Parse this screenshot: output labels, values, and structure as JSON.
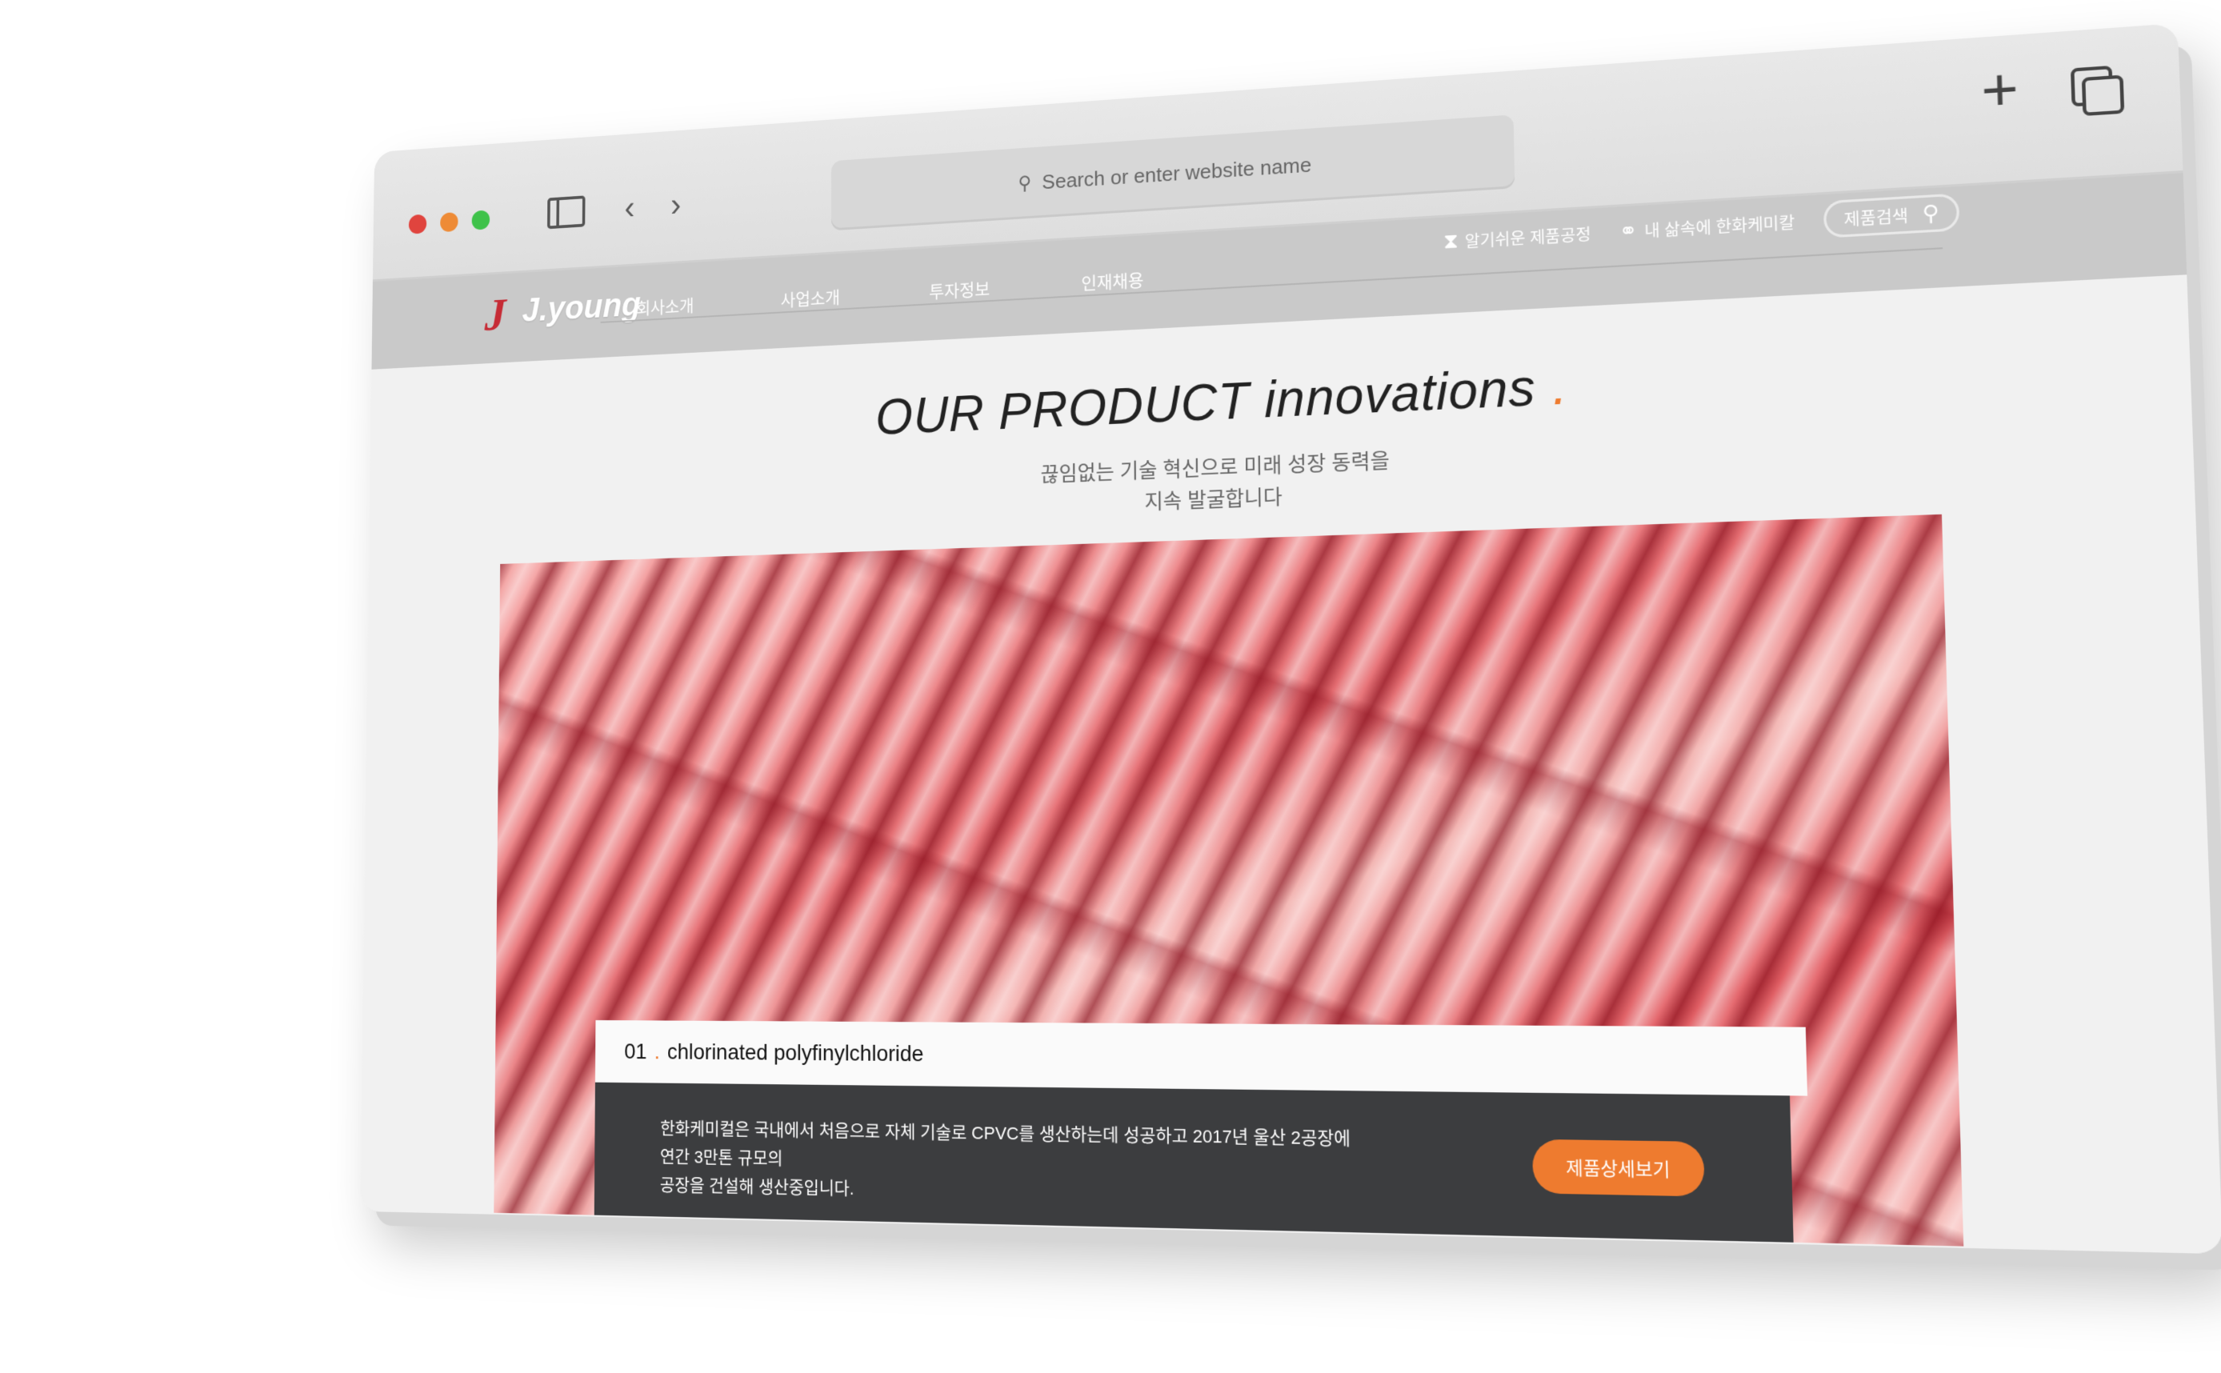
{
  "browser": {
    "address_placeholder": "Search or enter website name"
  },
  "site": {
    "logo_text": "J.young",
    "nav": [
      "회사소개",
      "사업소개",
      "투자정보",
      "인재채용"
    ],
    "util": {
      "process_label": "알기쉬운 제품공정",
      "life_label": "내 삶속에 한화케미칼",
      "search_label": "제품검색"
    }
  },
  "main": {
    "title": "OUR PRODUCT innovations",
    "title_dot": ".",
    "subtitle_line1": "끊임없는 기술 혁신으로 미래 성장 동력을",
    "subtitle_line2": "지속 발굴합니다"
  },
  "product": {
    "number": "01",
    "dot": ".",
    "name": "chlorinated polyfinylchloride",
    "description_line1": "한화케미컬은 국내에서 처음으로 자체 기술로 CPVC를 생산하는데 성공하고 2017년 울산 2공장에 연간 3만톤 규모의",
    "description_line2": "공장을 건설해 생산중입니다.",
    "button_label": "제품상세보기"
  },
  "colors": {
    "accent": "#ee7b2f",
    "logo_red": "#c62b35",
    "card_dark": "#3c3d3f",
    "nav_bar": "#c9c9c9"
  }
}
